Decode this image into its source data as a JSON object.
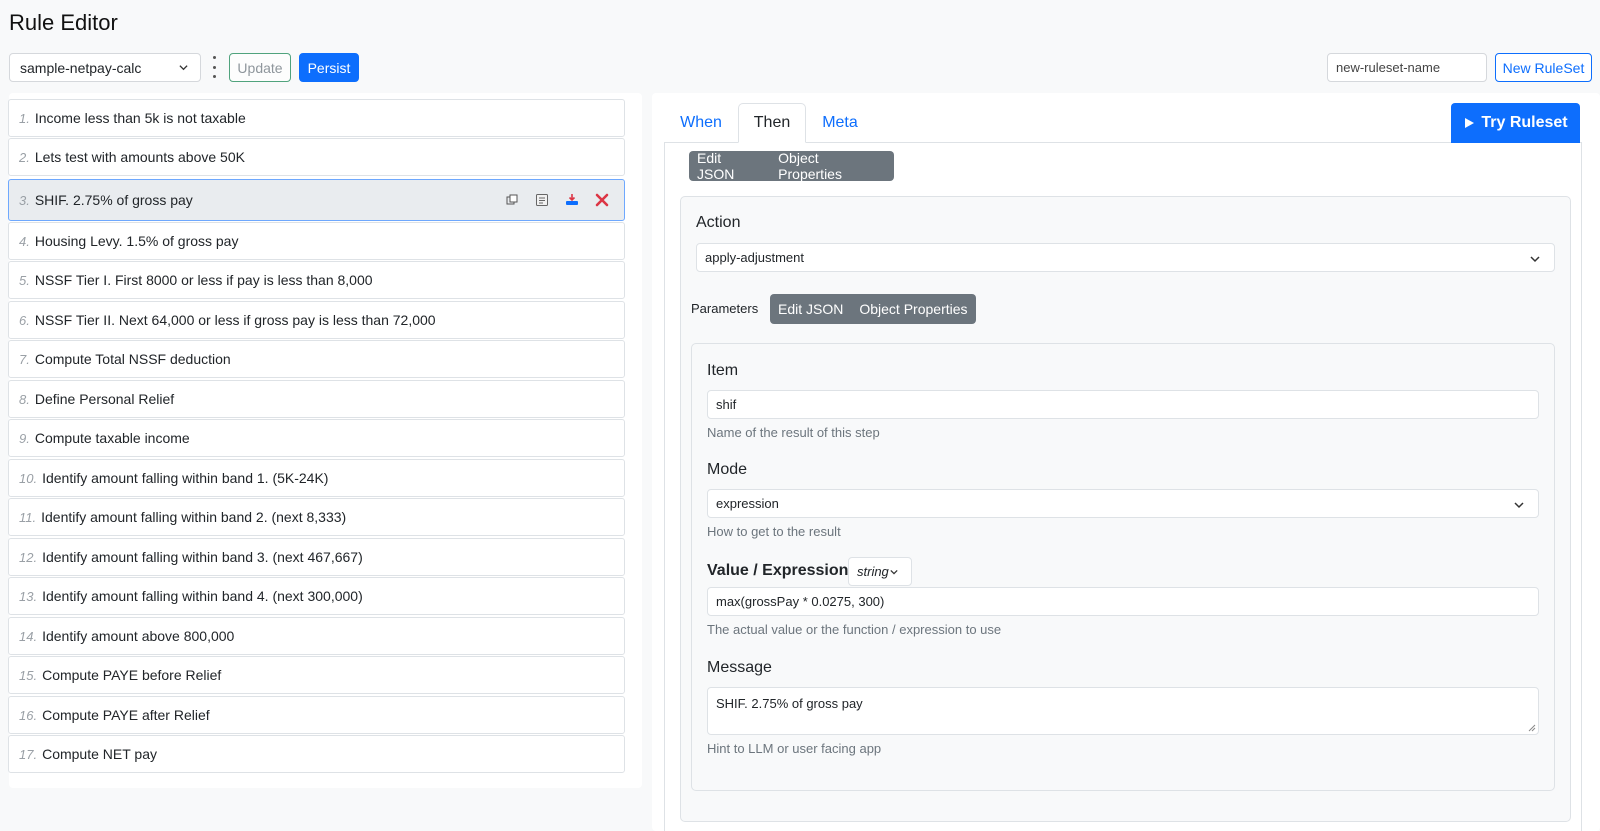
{
  "page": {
    "title": "Rule Editor"
  },
  "toolbar": {
    "ruleset_selected": "sample-netpay-calc",
    "update_label": "Update",
    "persist_label": "Persist",
    "new_ruleset_placeholder": "new-ruleset-name",
    "new_ruleset_label": "New RuleSet"
  },
  "rules": [
    {
      "num": "1.",
      "label": "Income less than 5k is not taxable"
    },
    {
      "num": "2.",
      "label": "Lets test with amounts above 50K"
    },
    {
      "num": "3.",
      "label": "SHIF. 2.75% of gross pay"
    },
    {
      "num": "4.",
      "label": "Housing Levy. 1.5% of gross pay"
    },
    {
      "num": "5.",
      "label": "NSSF Tier I. First 8000 or less if pay is less than 8,000"
    },
    {
      "num": "6.",
      "label": "NSSF Tier II. Next 64,000 or less if gross pay is less than 72,000"
    },
    {
      "num": "7.",
      "label": "Compute Total NSSF deduction"
    },
    {
      "num": "8.",
      "label": "Define Personal Relief"
    },
    {
      "num": "9.",
      "label": "Compute taxable income"
    },
    {
      "num": "10.",
      "label": "Identify amount falling within band 1. (5K-24K)"
    },
    {
      "num": "11.",
      "label": "Identify amount falling within band 2. (next 8,333)"
    },
    {
      "num": "12.",
      "label": "Identify amount falling within band 3. (next 467,667)"
    },
    {
      "num": "13.",
      "label": "Identify amount falling within band 4. (next 300,000)"
    },
    {
      "num": "14.",
      "label": "Identify amount above 800,000"
    },
    {
      "num": "15.",
      "label": "Compute PAYE before Relief"
    },
    {
      "num": "16.",
      "label": "Compute PAYE after Relief"
    },
    {
      "num": "17.",
      "label": "Compute NET pay"
    }
  ],
  "selected_rule_index": 2,
  "tabs": {
    "when": "When",
    "then": "Then",
    "meta": "Meta",
    "active": "Then"
  },
  "try_ruleset_label": "Try Ruleset",
  "then_toggle": {
    "edit_json": "Edit JSON",
    "object_properties": "Object Properties"
  },
  "action": {
    "label": "Action",
    "value": "apply-adjustment"
  },
  "parameters": {
    "label": "Parameters",
    "edit_json": "Edit JSON",
    "object_properties": "Object Properties",
    "item": {
      "label": "Item",
      "value": "shif",
      "help": "Name of the result of this step"
    },
    "mode": {
      "label": "Mode",
      "value": "expression",
      "help": "How to get to the result"
    },
    "value_expression": {
      "label": "Value / Expression",
      "type": "string",
      "value": "max(grossPay * 0.0275, 300)",
      "help": "The actual value or the function / expression to use"
    },
    "message": {
      "label": "Message",
      "value": "SHIF. 2.75% of gross pay",
      "help": "Hint to LLM or user facing app"
    }
  },
  "colors": {
    "primary": "#0d6efd",
    "danger": "#dc3545",
    "secondary": "#6c757d"
  }
}
